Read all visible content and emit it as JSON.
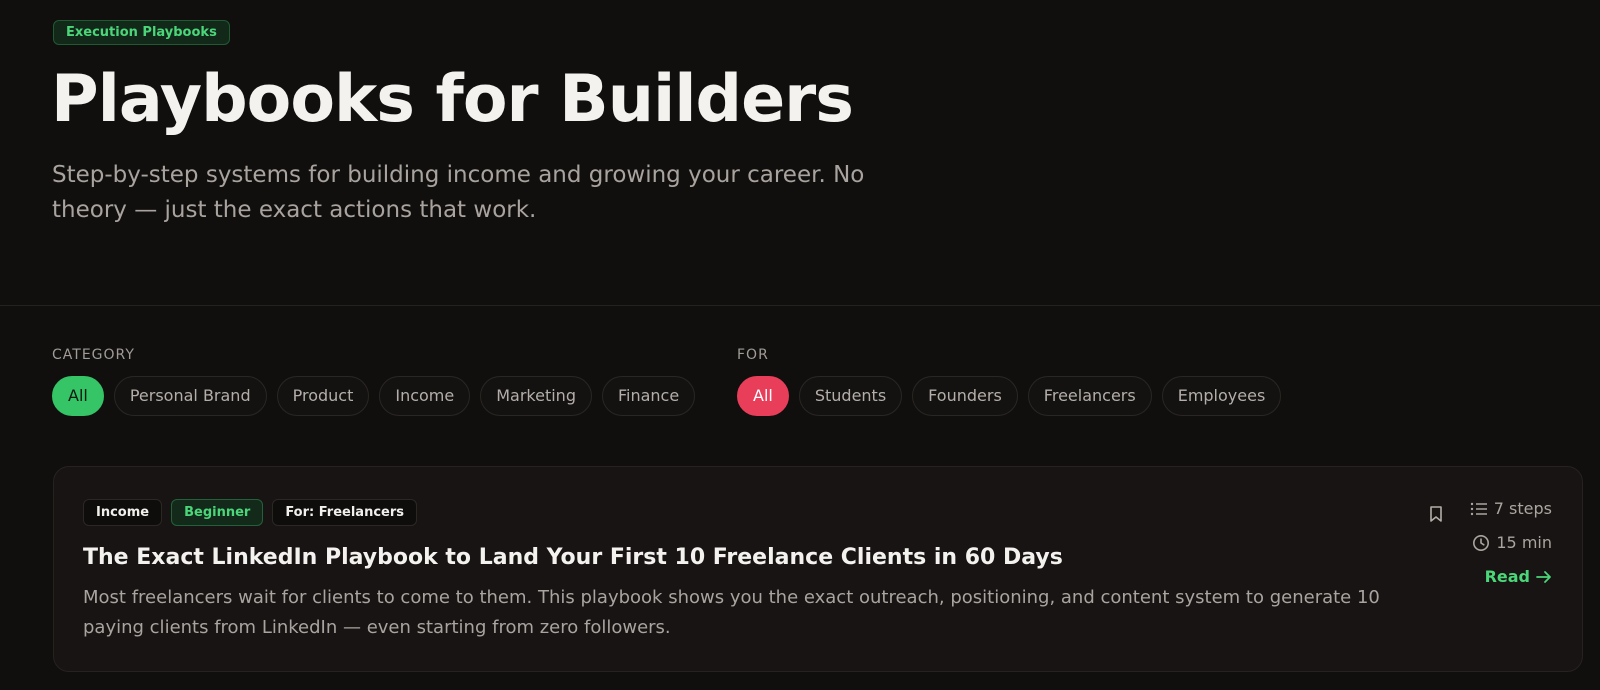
{
  "hero": {
    "eyebrow": "Execution Playbooks",
    "title": "Playbooks for Builders",
    "subtitle": "Step-by-step systems for building income and growing your career. No theory — just the exact actions that work."
  },
  "filters": {
    "category": {
      "label": "CATEGORY",
      "options": [
        "All",
        "Personal Brand",
        "Product",
        "Income",
        "Marketing",
        "Finance"
      ],
      "selected": "All"
    },
    "audience": {
      "label": "FOR",
      "options": [
        "All",
        "Students",
        "Founders",
        "Freelancers",
        "Employees"
      ],
      "selected": "All"
    }
  },
  "playbooks": [
    {
      "tags": [
        "Income",
        "Beginner",
        "For: Freelancers"
      ],
      "title": "The Exact LinkedIn Playbook to Land Your First 10 Freelance Clients in 60 Days",
      "description": "Most freelancers wait for clients to come to them. This playbook shows you the exact outreach, positioning, and content system to generate 10 paying clients from LinkedIn — even starting from zero followers.",
      "steps": "7 steps",
      "time": "15 min",
      "read_label": "Read"
    }
  ],
  "colors": {
    "background": "#110f0e",
    "accent_green": "#35c466",
    "accent_red": "#e83e5a",
    "text_muted": "#a8a39e"
  },
  "icons": [
    "bookmark-icon",
    "list-icon",
    "clock-icon",
    "arrow-right-icon"
  ]
}
